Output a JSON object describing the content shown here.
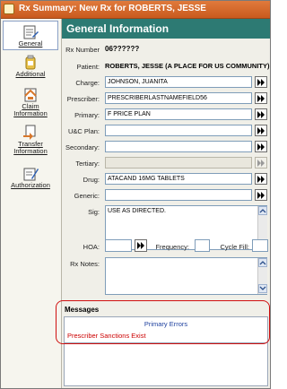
{
  "window": {
    "title": "Rx Summary: New Rx for ROBERTS, JESSE"
  },
  "sidebar": {
    "items": [
      {
        "label": "General",
        "icon": "general-icon",
        "active": true
      },
      {
        "label": "Additional",
        "icon": "additional-icon"
      },
      {
        "label": "Claim Information",
        "label_line1": "Claim",
        "label_line2": "Information",
        "icon": "claim-icon"
      },
      {
        "label": "Transfer Information",
        "label_line1": "Transfer",
        "label_line2": "Information",
        "icon": "transfer-icon"
      },
      {
        "label": "Authorization",
        "icon": "authorization-icon"
      }
    ]
  },
  "header": {
    "title": "General Information"
  },
  "form": {
    "rx_number_label": "Rx Number",
    "rx_number": "06??????",
    "patient_label": "Patient:",
    "patient": "ROBERTS, JESSE (A PLACE FOR US COMMUNITY)",
    "charge_label": "Charge:",
    "charge": "JOHNSON, JUANITA",
    "prescriber_label": "Prescriber:",
    "prescriber": "PRESCRIBERLASTNAMEFIELD56",
    "primary_label": "Primary:",
    "primary": "F PRICE PLAN",
    "uc_plan_label": "U&C Plan:",
    "uc_plan": "",
    "secondary_label": "Secondary:",
    "secondary": "",
    "tertiary_label": "Tertiary:",
    "tertiary": "",
    "drug_label": "Drug:",
    "drug": "ATACAND 16MG TABLETS",
    "generic_label": "Generic:",
    "generic": "",
    "sig_label": "Sig:",
    "sig": "USE AS DIRECTED.",
    "hoa_label": "HOA:",
    "hoa": "",
    "frequency_label": "Frequency:",
    "frequency": "",
    "cycle_fill_label": "Cycle Fill:",
    "cycle_fill": "",
    "rx_notes_label": "Rx Notes:",
    "rx_notes": ""
  },
  "messages": {
    "title": "Messages",
    "header": "Primary Errors",
    "error": "Prescriber Sanctions Exist"
  },
  "colors": {
    "title_bar": "#d46a2a",
    "header": "#2d7a73",
    "error": "#cc0000",
    "link": "#1c3f9e",
    "highlight_ring": "#d01010"
  }
}
